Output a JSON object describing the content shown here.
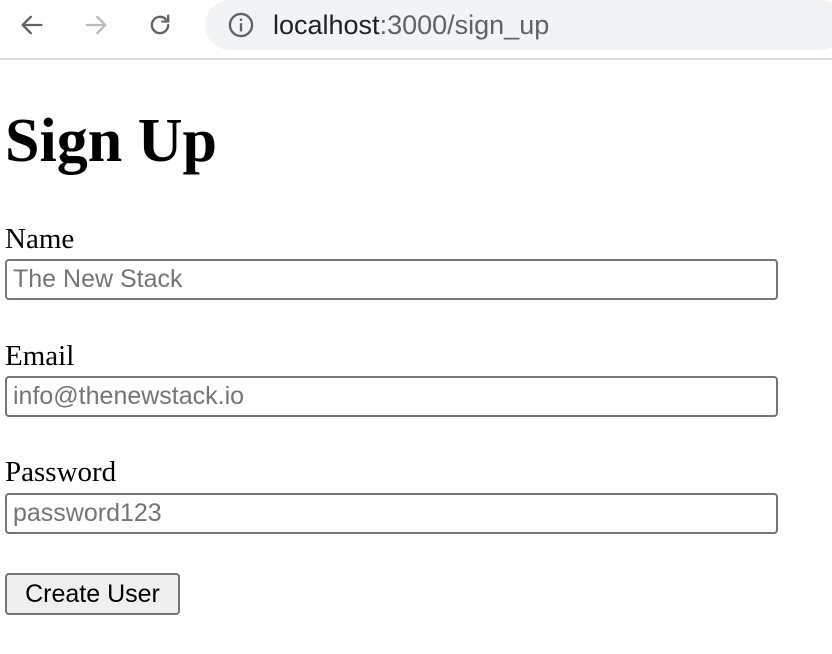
{
  "browser": {
    "url_host": "localhost",
    "url_path": ":3000/sign_up",
    "icons": {
      "back": "arrow-left-icon",
      "forward": "arrow-right-icon",
      "reload": "reload-icon",
      "info": "info-icon"
    },
    "forward_enabled": false
  },
  "page": {
    "title": "Sign Up"
  },
  "form": {
    "name": {
      "label": "Name",
      "placeholder": "The New Stack",
      "value": ""
    },
    "email": {
      "label": "Email",
      "placeholder": "info@thenewstack.io",
      "value": ""
    },
    "password": {
      "label": "Password",
      "placeholder": "password123",
      "value": ""
    },
    "submit_label": "Create User"
  }
}
